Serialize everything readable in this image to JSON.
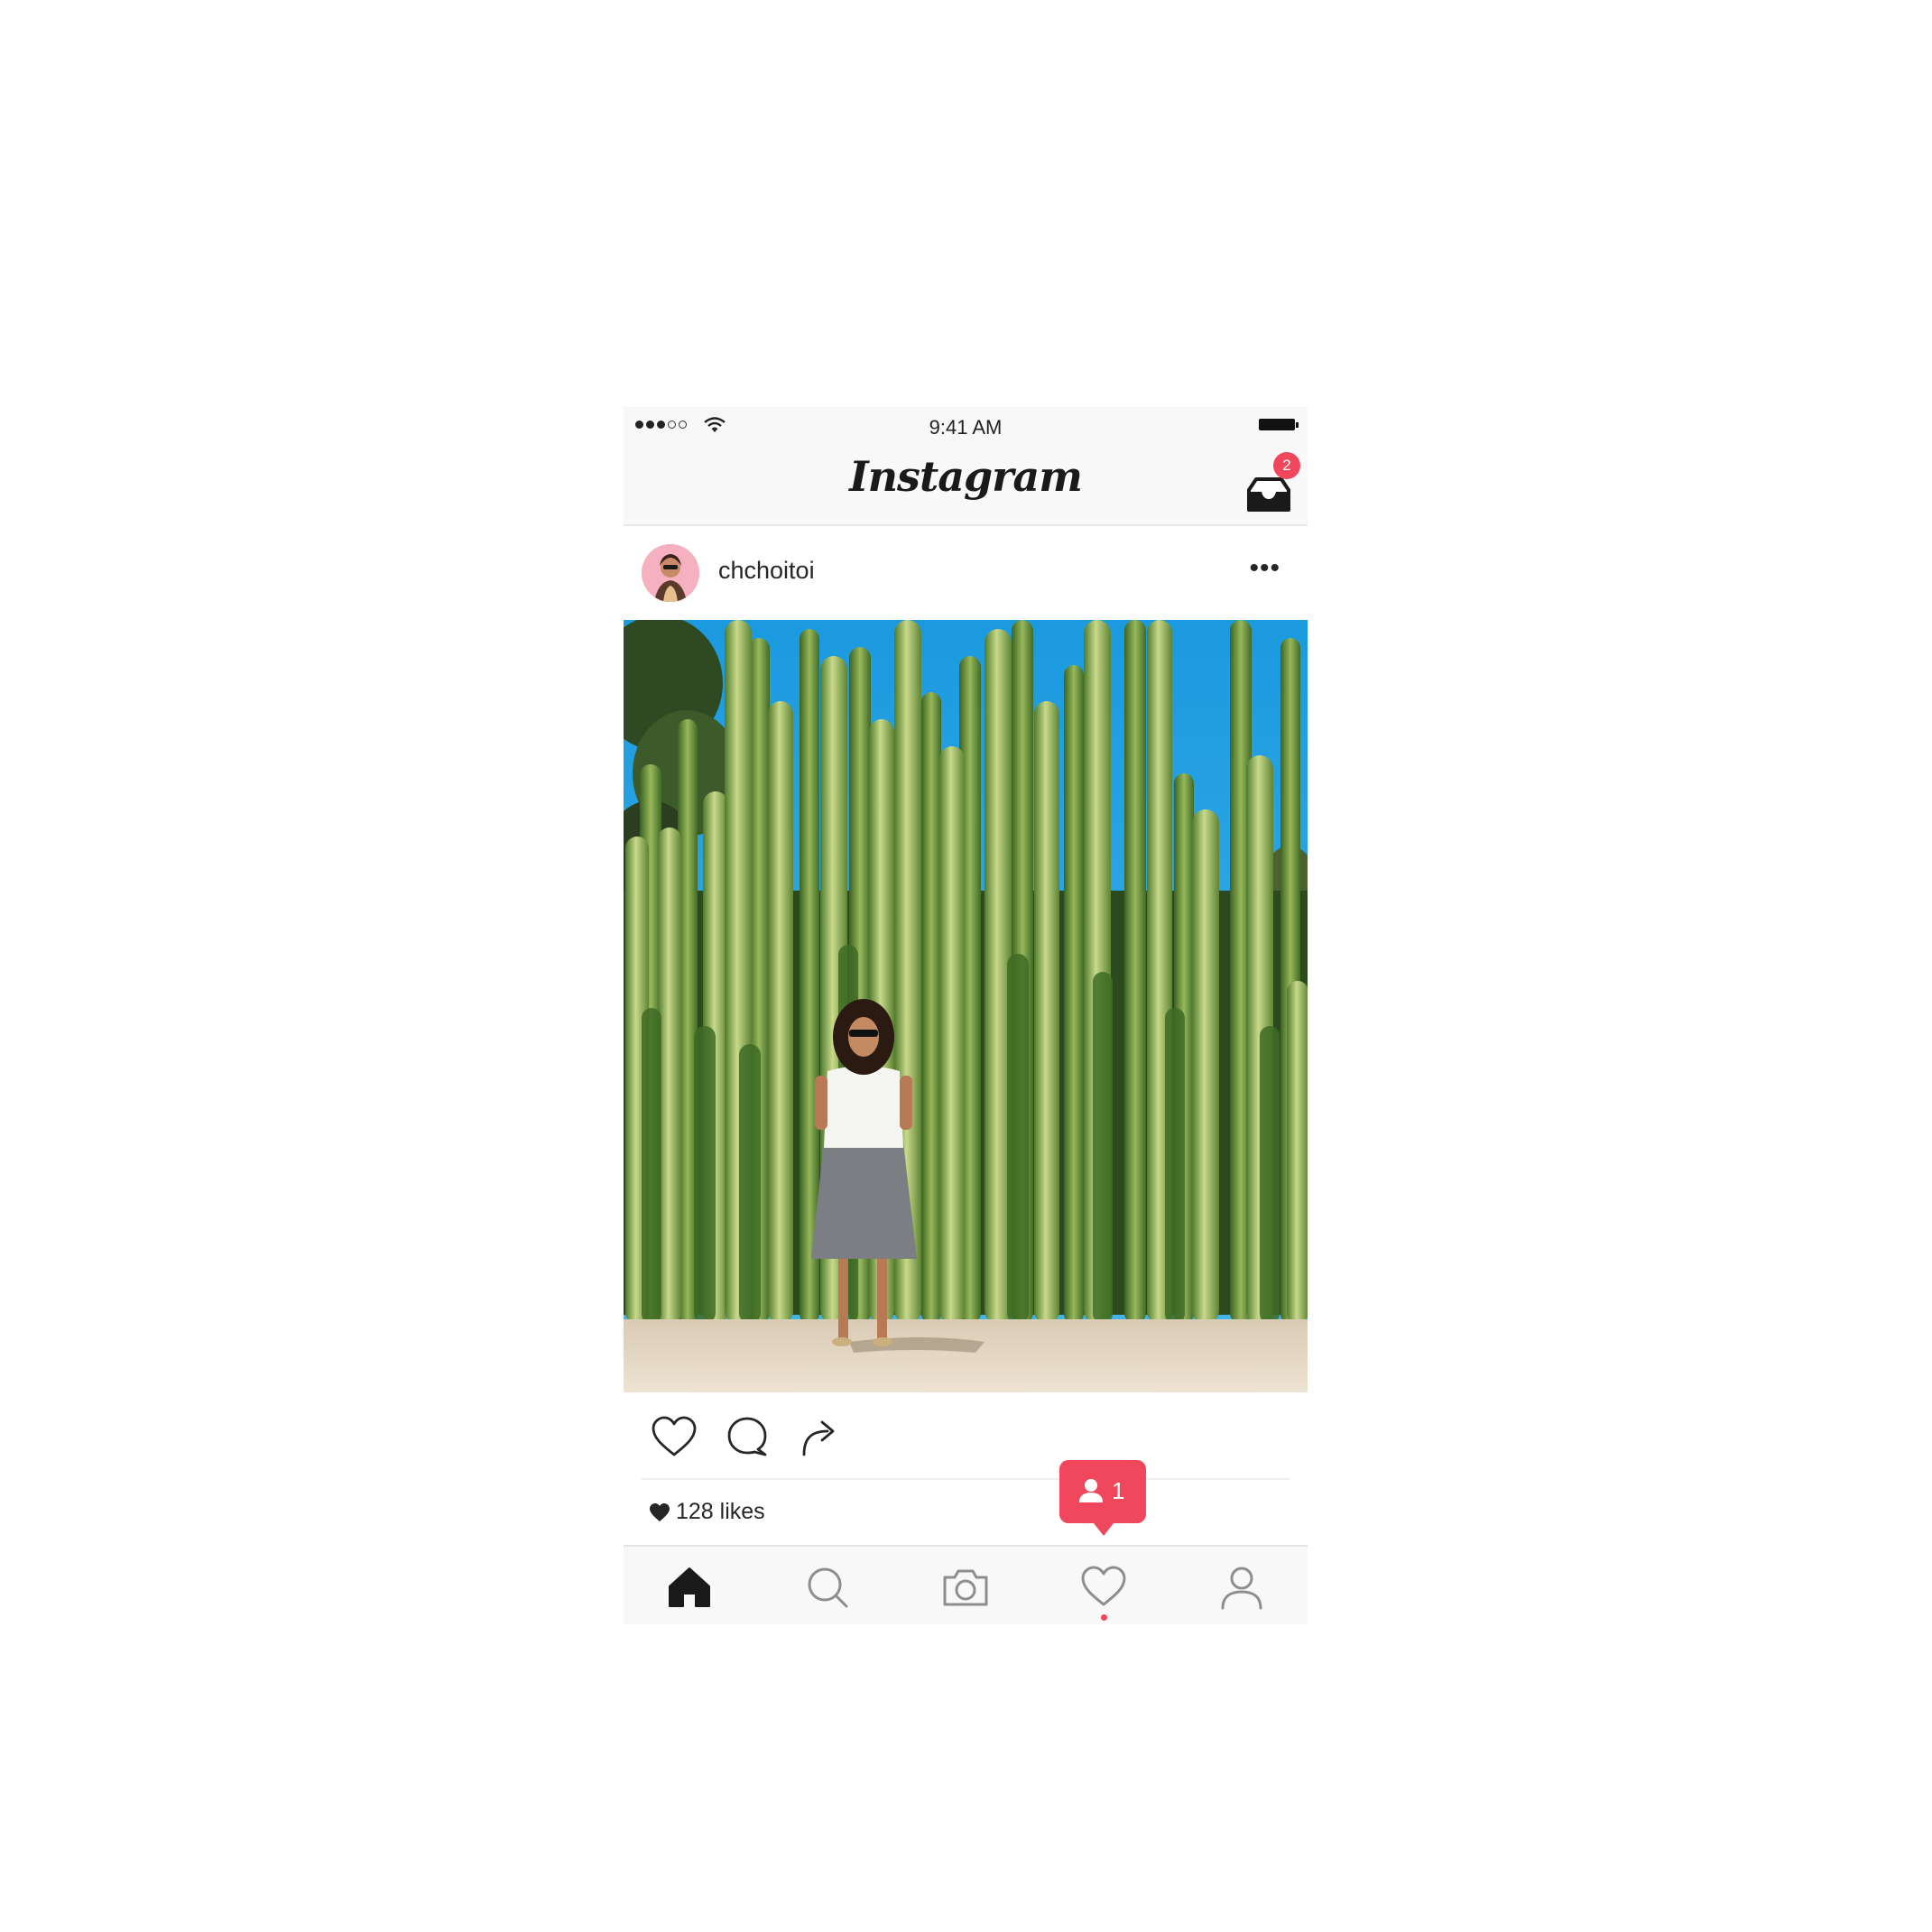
{
  "status_bar": {
    "time": "9:41 AM",
    "signal_filled": 3,
    "signal_empty": 2
  },
  "nav": {
    "logo": "Instagram",
    "inbox_badge": "2"
  },
  "post": {
    "username": "chchoitoi",
    "more_label": "•••",
    "likes": "128 likes"
  },
  "activity_notification": {
    "count": "1"
  },
  "tabs": [
    {
      "name": "home",
      "icon": "home-icon"
    },
    {
      "name": "search",
      "icon": "search-icon"
    },
    {
      "name": "camera",
      "icon": "camera-icon"
    },
    {
      "name": "activity",
      "icon": "heart-icon"
    },
    {
      "name": "profile",
      "icon": "person-icon"
    }
  ],
  "colors": {
    "accent": "#f0475c",
    "bar_background": "#f8f8f8",
    "text": "#262626"
  }
}
